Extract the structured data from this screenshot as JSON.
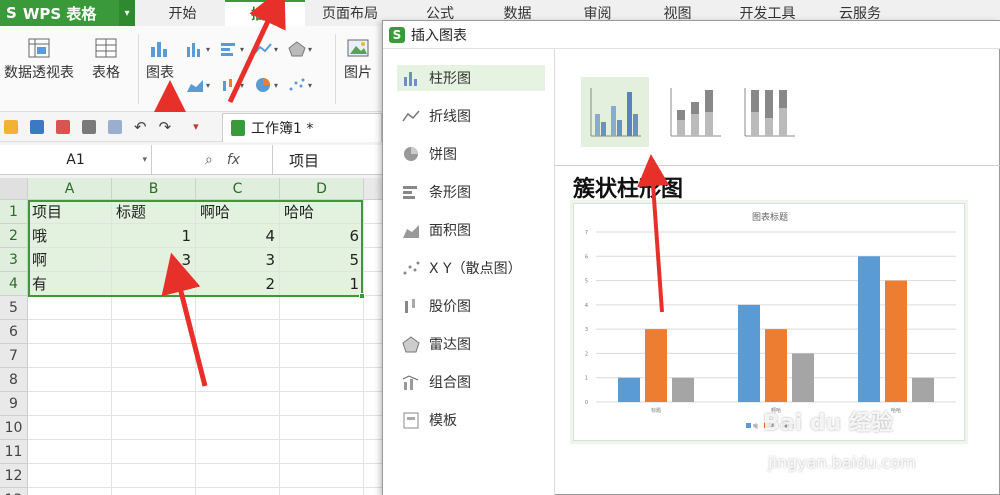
{
  "app": {
    "name": "WPS 表格"
  },
  "tabs": [
    "开始",
    "插入",
    "页面布局",
    "公式",
    "数据",
    "审阅",
    "视图",
    "开发工具",
    "云服务"
  ],
  "active_tab_index": 1,
  "ribbon": {
    "pivot_label": "数据透视表",
    "table_label": "表格",
    "chart_label": "图表",
    "picture_label": "图片"
  },
  "workbook_tab": "工作簿1 *",
  "formula_bar": {
    "cell_ref": "A1",
    "fx_label": "fx",
    "value": "项目"
  },
  "sheet": {
    "columns": [
      "A",
      "B",
      "C",
      "D"
    ],
    "row_numbers": [
      "1",
      "2",
      "3",
      "4",
      "5",
      "6",
      "7",
      "8",
      "9",
      "10",
      "11",
      "12",
      "13"
    ],
    "rows": [
      [
        "项目",
        "标题",
        "啊哈",
        "哈哈"
      ],
      [
        "哦",
        "1",
        "4",
        "6"
      ],
      [
        "啊",
        "3",
        "3",
        "5"
      ],
      [
        "有",
        "1",
        "2",
        "1"
      ]
    ]
  },
  "dialog": {
    "title": "插入图表",
    "chart_types": [
      "柱形图",
      "折线图",
      "饼图",
      "条形图",
      "面积图",
      "X Y（散点图）",
      "股价图",
      "雷达图",
      "组合图",
      "模板"
    ],
    "active_type_index": 0,
    "selected_subtype_title": "簇状柱形图",
    "colors": {
      "s1": "#5b9bd5",
      "s2": "#ed7d31",
      "s3": "#a5a5a5"
    }
  },
  "chart_data": {
    "type": "bar",
    "title": "图表标题",
    "categories": [
      "标题",
      "啊哈",
      "哈哈"
    ],
    "series": [
      {
        "name": "哦",
        "values": [
          1,
          4,
          6
        ]
      },
      {
        "name": "啊",
        "values": [
          3,
          3,
          5
        ]
      },
      {
        "name": "有",
        "values": [
          1,
          2,
          1
        ]
      }
    ],
    "ylim": [
      0,
      7
    ],
    "yticks": [
      "0",
      "1",
      "2",
      "3",
      "4",
      "5",
      "6",
      "7"
    ],
    "grid": true,
    "legend": "bottom"
  },
  "watermark": {
    "brand": "Bai du 经验",
    "url": "jingyan.baidu.com"
  }
}
